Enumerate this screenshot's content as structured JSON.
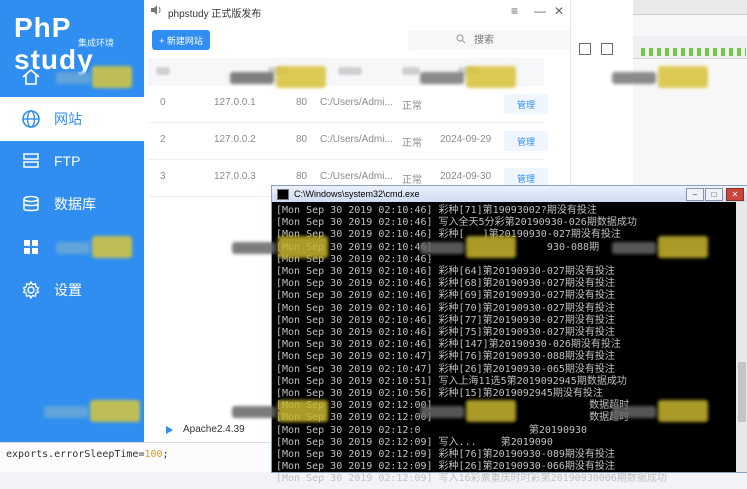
{
  "phpstudy": {
    "logo": "PhP study",
    "logo_sub": "集成环境",
    "title": "phpstudy 正式版发布",
    "new_site_label": "+ 新建网站",
    "search_placeholder": "搜索",
    "nav": [
      {
        "label": "",
        "icon": "home-icon"
      },
      {
        "label": "网站",
        "icon": "globe-icon"
      },
      {
        "label": "FTP",
        "icon": "ftp-icon"
      },
      {
        "label": "数据库",
        "icon": "database-icon"
      },
      {
        "label": "",
        "icon": "grid-icon"
      },
      {
        "label": "设置",
        "icon": "gear-icon"
      }
    ],
    "rows": [
      {
        "id": "0",
        "ip": "127.0.0.1",
        "port": "80",
        "path": "C:/Users/Admi...",
        "status": "正常",
        "date": "",
        "action": "管理"
      },
      {
        "id": "2",
        "ip": "127.0.0.2",
        "port": "80",
        "path": "C:/Users/Admi...",
        "status": "正常",
        "date": "2024-09-29",
        "action": "管理"
      },
      {
        "id": "3",
        "ip": "127.0.0.3",
        "port": "80",
        "path": "C:/Users/Admi...",
        "status": "正常",
        "date": "2024-09-30",
        "action": "管理"
      }
    ],
    "service": "Apache2.4.39"
  },
  "cmd": {
    "title": "C:\\Windows\\system32\\cmd.exe",
    "lines": [
      "[Mon Sep 30 2019 02:10:46] 彩种[71]第19093002?期没有投注",
      "[Mon Sep 30 2019 02:10:46] 写入全天5分彩第20190930-026期数据成功",
      "[Mon Sep 30 2019 02:10:46] 彩种[   ]第20190930-027期没有投注",
      "[Mon Sep 30 2019 02:10:46]                   930-088期",
      "[Mon Sep 30 2019 02:10:46]",
      "[Mon Sep 30 2019 02:10:46] 彩种[64]第20190930-027期没有投注",
      "[Mon Sep 30 2019 02:10:46] 彩种[68]第20190930-027期没有投注",
      "[Mon Sep 30 2019 02:10:46] 彩种[69]第20190930-027期没有投注",
      "[Mon Sep 30 2019 02:10:46] 彩种[70]第20190930-027期没有投注",
      "[Mon Sep 30 2019 02:10:46] 彩种[77]第20190930-027期没有投注",
      "[Mon Sep 30 2019 02:10:46] 彩种[75]第20190930-027期没有投注",
      "[Mon Sep 30 2019 02:10:46] 彩种[147]第20190930-026期没有投注",
      "[Mon Sep 30 2019 02:10:47] 彩种[76]第20190930-088期没有投注",
      "[Mon Sep 30 2019 02:10:47] 彩种[26]第20190930-065期没有投注",
      "[Mon Sep 30 2019 02:10:51] 写入上海11选5第2019092945期数据成功",
      "[Mon Sep 30 2019 02:10:56] 彩种[15]第2019092945期没有投注",
      "[Mon Sep 30 2019 02:12:00]                          数据超时",
      "[Mon Sep 30 2019 02:12:00]                          数据超时",
      "[Mon Sep 30 2019 02:12:0                  第20190930",
      "[Mon Sep 30 2019 02:12:09] 写入...    第2019090",
      "[Mon Sep 30 2019 02:12:09] 彩种[76]第20190930-089期没有投注",
      "[Mon Sep 30 2019 02:12:09] 彩种[26]第20190930-066期没有投注",
      "[Mon Sep 30 2019 02:12:09] 写入16彩票重庆时时彩第20190930006期数据成功"
    ]
  },
  "editor": {
    "code_prefix": "exports.errorSleepTime=",
    "code_number": "100",
    "code_suffix": ";"
  }
}
